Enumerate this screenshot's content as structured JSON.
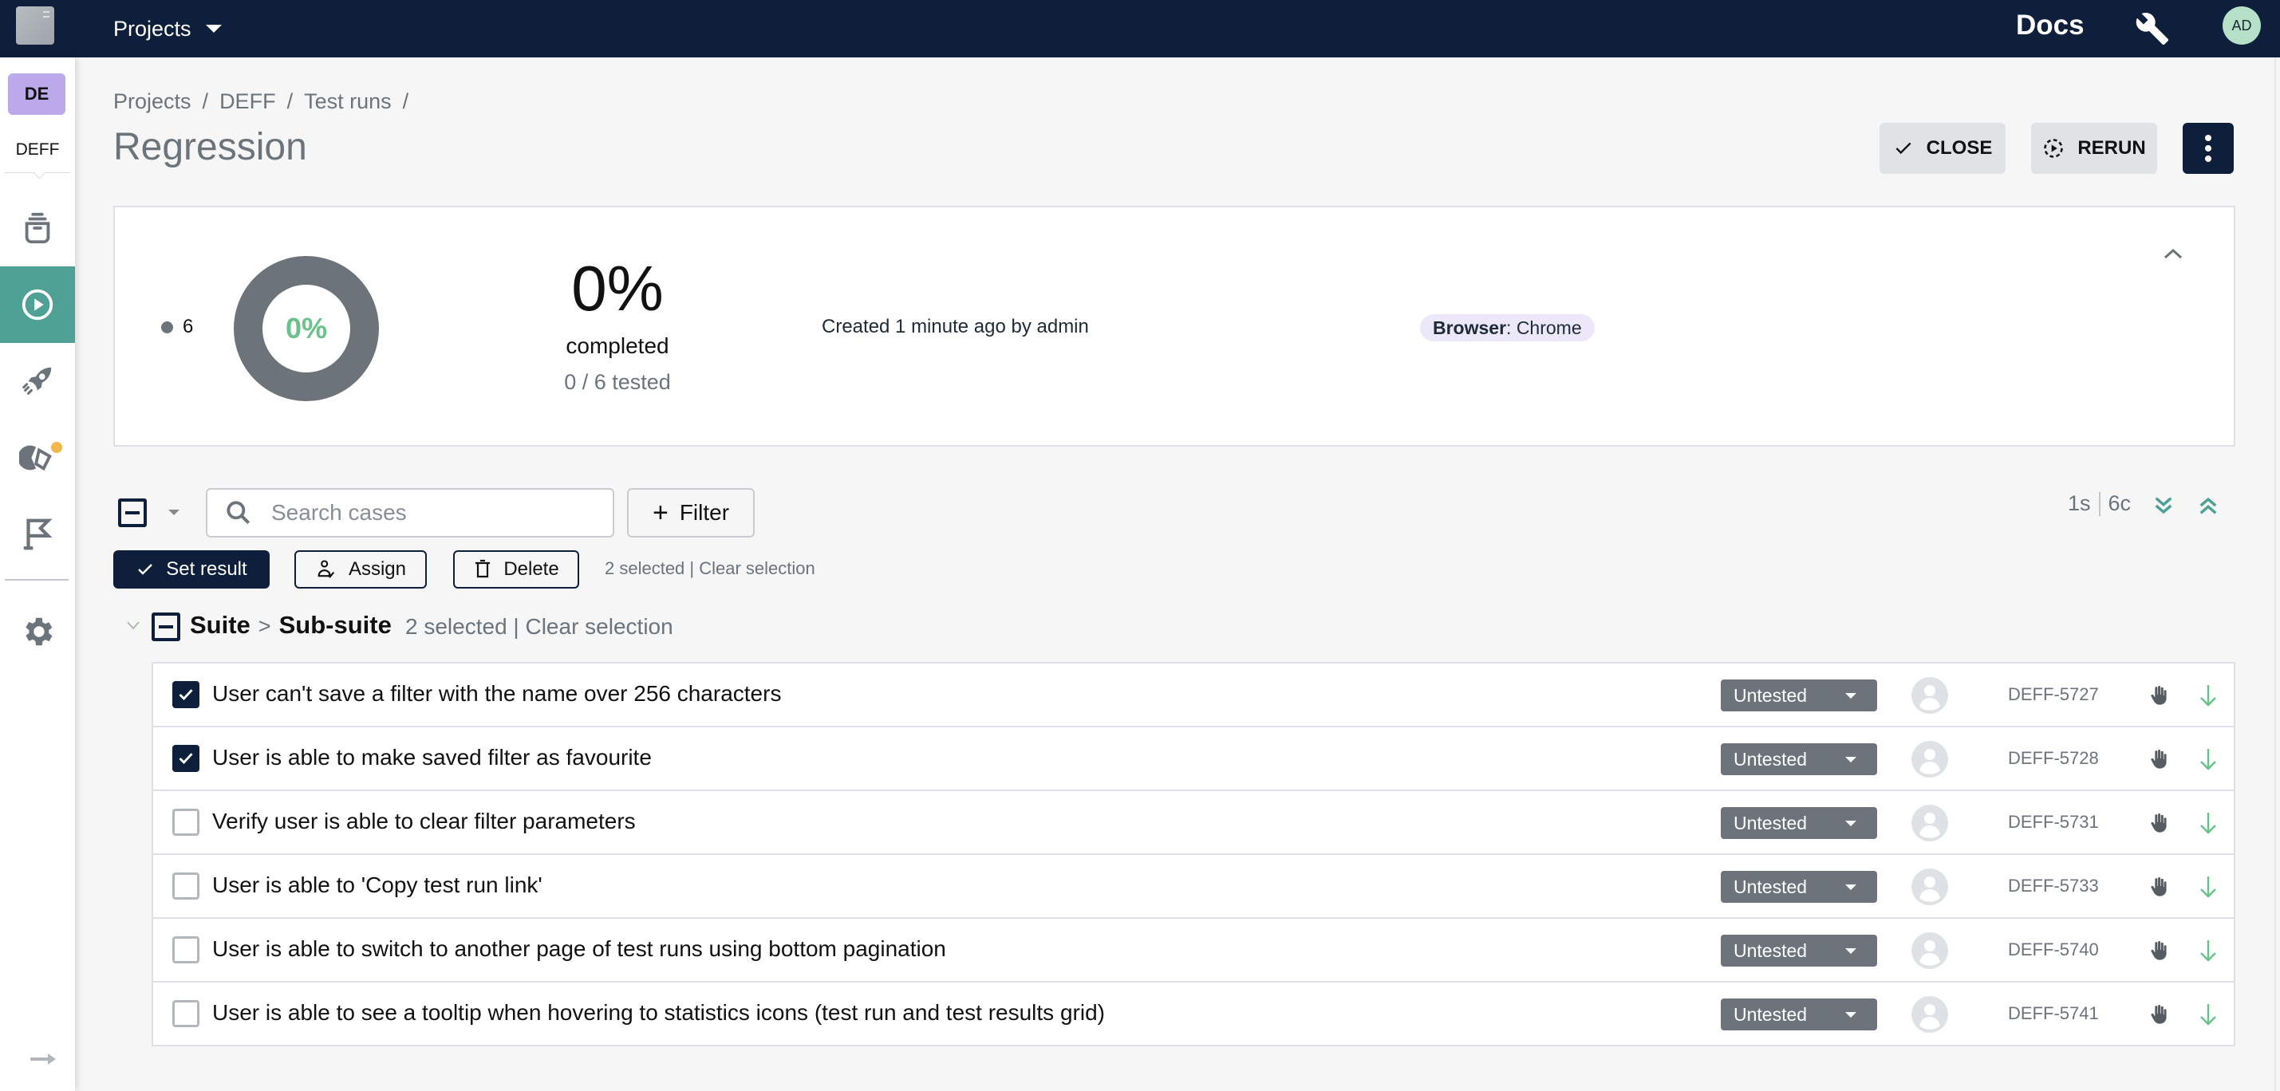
{
  "header": {
    "projects_menu_label": "Projects",
    "docs_label": "Docs",
    "user_initials": "AD"
  },
  "sidebar": {
    "project_badge": "DE",
    "project_name": "DEFF",
    "items": [
      {
        "name": "test-cases",
        "icon": "archive-icon",
        "active": false
      },
      {
        "name": "test-runs",
        "icon": "play-circle-icon",
        "active": true
      },
      {
        "name": "launches",
        "icon": "rocket-icon",
        "active": false
      },
      {
        "name": "analytics",
        "icon": "pie-chart-icon",
        "active": false,
        "notification": true
      },
      {
        "name": "milestones",
        "icon": "flag-icon",
        "active": false
      },
      {
        "name": "settings",
        "icon": "gear-icon",
        "active": false
      }
    ],
    "expand_icon": "arrow-right-icon"
  },
  "breadcrumb": [
    {
      "label": "Projects"
    },
    {
      "label": "DEFF"
    },
    {
      "label": "Test runs"
    }
  ],
  "breadcrumb_separator": "/",
  "page": {
    "title": "Regression",
    "close_label": "CLOSE",
    "rerun_label": "RERUN"
  },
  "summary": {
    "legend_count": "6",
    "donut_label": "0%",
    "completed_pct": "0%",
    "completed_label": "completed",
    "tested_label": "0 / 6 tested",
    "created_text": "Created 1 minute ago by admin",
    "tag_key": "Browser",
    "tag_value": ": Chrome",
    "colors": {
      "untested": "#6c737b",
      "passed_text": "#6cc08b"
    }
  },
  "chart_data": {
    "type": "pie",
    "title": "",
    "categories": [
      "Untested"
    ],
    "values": [
      6
    ],
    "center_label": "0%",
    "colors": [
      "#6c737b"
    ]
  },
  "toolbar": {
    "search_placeholder": "Search cases",
    "search_value": "",
    "filter_label": "Filter",
    "suites_count": "1s",
    "cases_count": "6c"
  },
  "actions": {
    "set_result_label": "Set result",
    "assign_label": "Assign",
    "delete_label": "Delete",
    "selected_text": "2 selected",
    "divider": " | ",
    "clear_label": "Clear selection"
  },
  "suite": {
    "name": "Suite",
    "separator": ">",
    "sub_name": "Sub-suite",
    "selected_text": "2 selected",
    "divider": " | ",
    "clear_label": "Clear selection"
  },
  "cases": [
    {
      "title": "User can't save a filter with the name over 256 characters",
      "checked": true,
      "status": "Untested",
      "id": "DEFF-5727"
    },
    {
      "title": "User is able to make saved filter as favourite",
      "checked": true,
      "status": "Untested",
      "id": "DEFF-5728"
    },
    {
      "title": "Verify user is able to clear filter parameters",
      "checked": false,
      "status": "Untested",
      "id": "DEFF-5731"
    },
    {
      "title": "User is able to 'Copy test run link'",
      "checked": false,
      "status": "Untested",
      "id": "DEFF-5733"
    },
    {
      "title": "User is able to switch to another page of test runs using bottom pagination",
      "checked": false,
      "status": "Untested",
      "id": "DEFF-5740"
    },
    {
      "title": "User is able to see a tooltip when hovering to statistics icons (test run and test results grid)",
      "checked": false,
      "status": "Untested",
      "id": "DEFF-5741"
    }
  ],
  "colors": {
    "navy": "#0d1f3a",
    "teal": "#4fa196",
    "gray": "#6c737b",
    "green": "#6cc08b",
    "purple_badge": "#bba9ec",
    "notification": "#f2b84b"
  }
}
